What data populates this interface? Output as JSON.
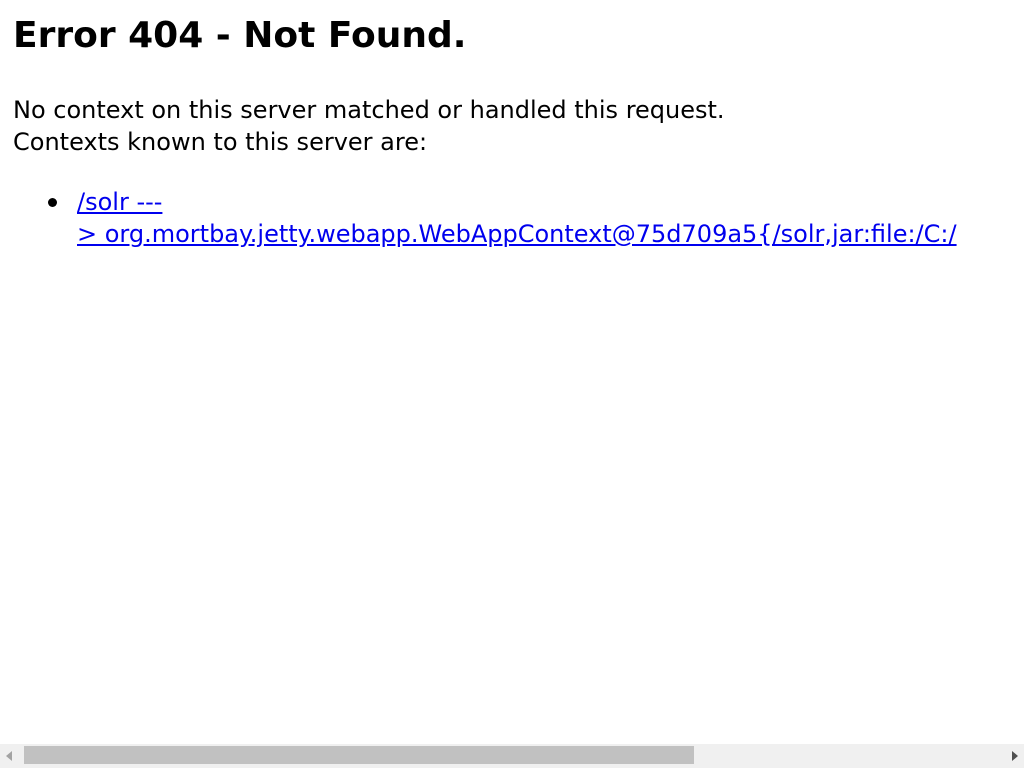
{
  "heading": "Error 404 - Not Found.",
  "message": {
    "line1": "No context on this server matched or handled this request.",
    "line2": "Contexts known to this server are:"
  },
  "contexts": [
    {
      "line1": "/solr ---",
      "line2": "> org.mortbay.jetty.webapp.WebAppContext@75d709a5{/solr,jar:file:/C:/"
    }
  ],
  "scrollbar": {
    "left_icon": "scroll-left-arrow-icon",
    "right_icon": "scroll-right-arrow-icon"
  }
}
